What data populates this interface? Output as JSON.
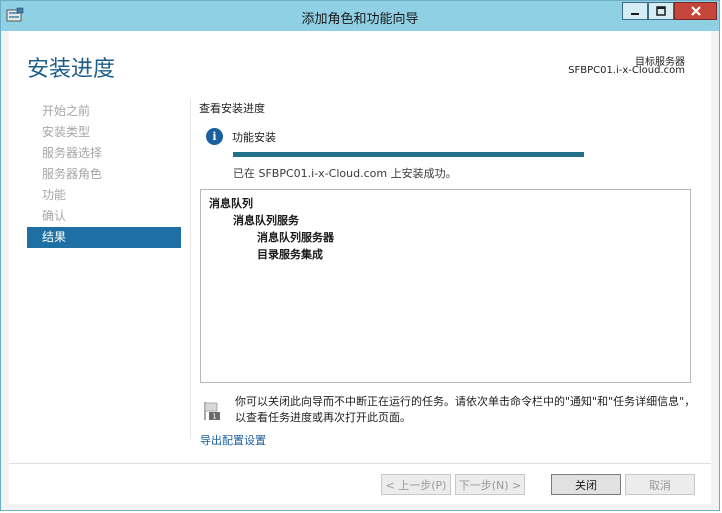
{
  "window": {
    "title": "添加角色和功能向导"
  },
  "header": {
    "page_title": "安装进度",
    "target_label": "目标服务器",
    "target_server": "SFBPC01.i-x-Cloud.com"
  },
  "nav": {
    "items": [
      {
        "label": "开始之前",
        "state": "disabled"
      },
      {
        "label": "安装类型",
        "state": "disabled"
      },
      {
        "label": "服务器选择",
        "state": "disabled"
      },
      {
        "label": "服务器角色",
        "state": "disabled"
      },
      {
        "label": "功能",
        "state": "disabled"
      },
      {
        "label": "确认",
        "state": "disabled"
      },
      {
        "label": "结果",
        "state": "active"
      }
    ]
  },
  "main": {
    "section_heading": "查看安装进度",
    "progress": {
      "label": "功能安装",
      "percent": 100,
      "status": "已在 SFBPC01.i-x-Cloud.com 上安装成功。"
    },
    "results": [
      {
        "text": "消息队列",
        "level": 0
      },
      {
        "text": "消息队列服务",
        "level": 1
      },
      {
        "text": "消息队列服务器",
        "level": 2
      },
      {
        "text": "目录服务集成",
        "level": 2
      }
    ],
    "note": "你可以关闭此向导而不中断正在运行的任务。请依次单击命令栏中的\"通知\"和\"任务详细信息\"，以查看任务进度或再次打开此页面。",
    "export_link": "导出配置设置"
  },
  "footer": {
    "prev_label": "< 上一步(P)",
    "next_label": "下一步(N) >",
    "close_label": "关闭",
    "cancel_label": "取消"
  },
  "colors": {
    "accent": "#1e70a4",
    "title_blue": "#1e5f8a",
    "progress": "#23708a",
    "titlebar": "#8fd0e4",
    "close_red": "#c7463b"
  },
  "icons": {
    "window": "server-manager-icon",
    "info": "info-icon",
    "note": "flag-icon"
  }
}
